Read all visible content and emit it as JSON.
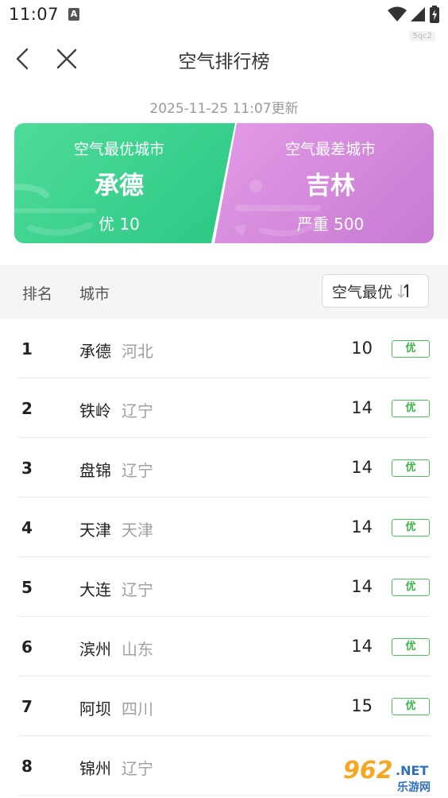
{
  "status_bar": {
    "time": "11:07",
    "notification_icon": "a-notification-icon",
    "icons": [
      "wifi-icon",
      "signal-icon",
      "battery-charging-icon"
    ]
  },
  "watermark_tag": "5qc2",
  "nav": {
    "title": "空气排行榜",
    "back_icon": "chevron-left-icon",
    "close_icon": "close-icon"
  },
  "update_time": "2025-11-25 11:07更新",
  "best_card": {
    "label": "空气最优城市",
    "city": "承德",
    "aqi_text": "优 10",
    "color": "#2bc884"
  },
  "worst_card": {
    "label": "空气最差城市",
    "city": "吉林",
    "aqi_text": "严重 500",
    "color": "#c77ad2"
  },
  "table_header": {
    "rank": "排名",
    "city": "城市",
    "sort_label": "空气最优",
    "sort_icon": "sort-arrows-icon"
  },
  "rows": [
    {
      "rank": "1",
      "city": "承德",
      "province": "河北",
      "aqi": "10",
      "level": "优"
    },
    {
      "rank": "2",
      "city": "铁岭",
      "province": "辽宁",
      "aqi": "14",
      "level": "优"
    },
    {
      "rank": "3",
      "city": "盘锦",
      "province": "辽宁",
      "aqi": "14",
      "level": "优"
    },
    {
      "rank": "4",
      "city": "天津",
      "province": "天津",
      "aqi": "14",
      "level": "优"
    },
    {
      "rank": "5",
      "city": "大连",
      "province": "辽宁",
      "aqi": "14",
      "level": "优"
    },
    {
      "rank": "6",
      "city": "滨州",
      "province": "山东",
      "aqi": "14",
      "level": "优"
    },
    {
      "rank": "7",
      "city": "阿坝",
      "province": "四川",
      "aqi": "15",
      "level": "优"
    },
    {
      "rank": "8",
      "city": "锦州",
      "province": "辽宁",
      "aqi": "",
      "level": ""
    }
  ],
  "level_color": "#3bb54a",
  "site_logo": {
    "main": "962",
    "net": ".NET",
    "sub": "乐游网"
  }
}
